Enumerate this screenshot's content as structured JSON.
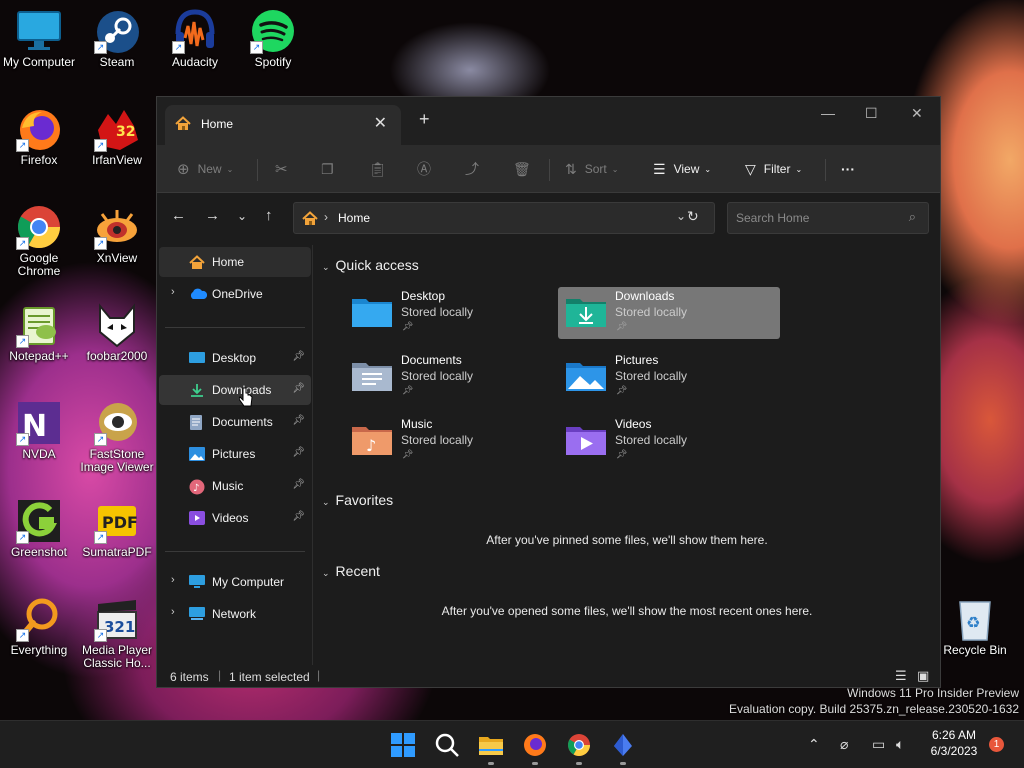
{
  "desktop_icons": [
    {
      "label": "My Computer"
    },
    {
      "label": "Steam"
    },
    {
      "label": "Audacity"
    },
    {
      "label": "Spotify"
    },
    {
      "label": "Firefox"
    },
    {
      "label": "IrfanView"
    },
    {
      "label": "Google Chrome"
    },
    {
      "label": "XnView"
    },
    {
      "label": "Notepad++"
    },
    {
      "label": "foobar2000"
    },
    {
      "label": "NVDA"
    },
    {
      "label": "FastStone Image Viewer"
    },
    {
      "label": "Greenshot"
    },
    {
      "label": "SumatraPDF"
    },
    {
      "label": "Everything"
    },
    {
      "label": "Media Player Classic Ho..."
    },
    {
      "label": "Recycle Bin"
    }
  ],
  "window": {
    "tab_title": "Home",
    "new_tab": "+",
    "toolbar": {
      "new_label": "New",
      "sort_label": "Sort",
      "view_label": "View",
      "filter_label": "Filter",
      "more_label": "···"
    },
    "address": {
      "path": "Home"
    },
    "search": {
      "placeholder": "Search Home"
    },
    "sidebar": {
      "top": [
        {
          "label": "Home"
        },
        {
          "label": "OneDrive"
        }
      ],
      "pinned": [
        {
          "label": "Desktop"
        },
        {
          "label": "Downloads"
        },
        {
          "label": "Documents"
        },
        {
          "label": "Pictures"
        },
        {
          "label": "Music"
        },
        {
          "label": "Videos"
        }
      ],
      "bottom": [
        {
          "label": "My Computer"
        },
        {
          "label": "Network"
        }
      ]
    },
    "quick_access": {
      "heading": "Quick access",
      "items": [
        {
          "name": "Desktop",
          "sub": "Stored locally"
        },
        {
          "name": "Downloads",
          "sub": "Stored locally"
        },
        {
          "name": "Documents",
          "sub": "Stored locally"
        },
        {
          "name": "Pictures",
          "sub": "Stored locally"
        },
        {
          "name": "Music",
          "sub": "Stored locally"
        },
        {
          "name": "Videos",
          "sub": "Stored locally"
        }
      ]
    },
    "favorites": {
      "heading": "Favorites",
      "message": "After you've pinned some files, we'll show them here."
    },
    "recent": {
      "heading": "Recent",
      "message": "After you've opened some files, we'll show the most recent ones here."
    },
    "status": {
      "items": "6 items",
      "selected": "1 item selected"
    }
  },
  "watermark": {
    "line1": "Windows 11 Pro Insider Preview",
    "line2": "Evaluation copy. Build 25375.zn_release.230520-1632"
  },
  "taskbar": {
    "time": "6:26 AM",
    "date": "6/3/2023",
    "notification_count": "1"
  }
}
